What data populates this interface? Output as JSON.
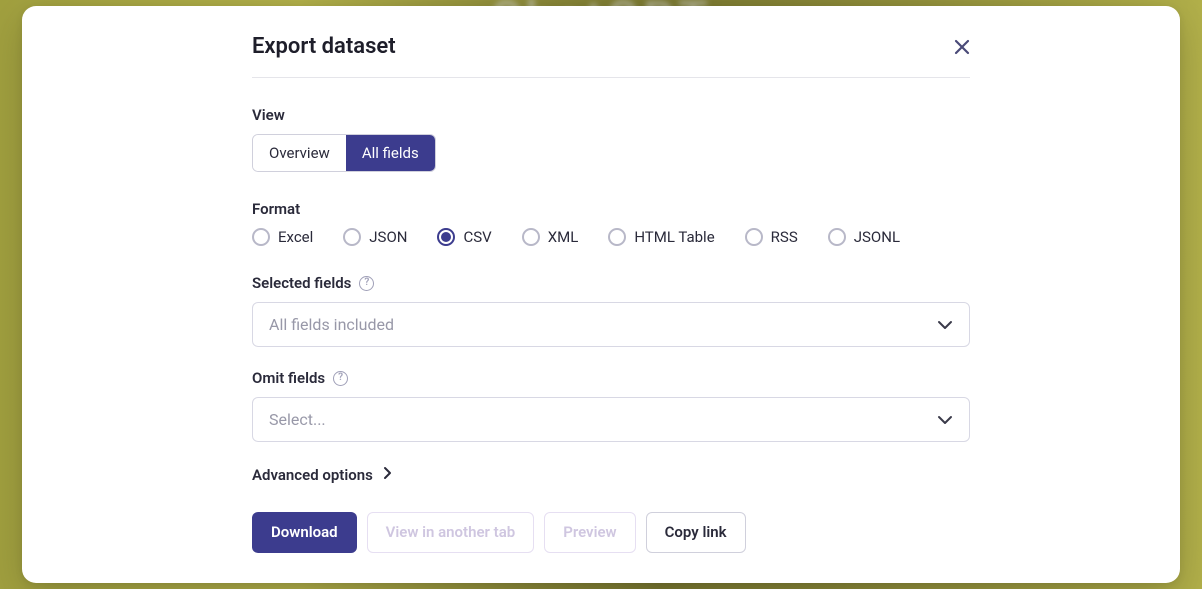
{
  "bg_blur_text": "ChatGPT",
  "modal": {
    "title": "Export dataset",
    "view_label": "View",
    "view_tabs": {
      "overview": "Overview",
      "all_fields": "All fields"
    },
    "format_label": "Format",
    "formats": {
      "excel": "Excel",
      "json": "JSON",
      "csv": "CSV",
      "xml": "XML",
      "html_table": "HTML Table",
      "rss": "RSS",
      "jsonl": "JSONL"
    },
    "selected_fields_label": "Selected fields",
    "selected_fields_placeholder": "All fields included",
    "omit_fields_label": "Omit fields",
    "omit_fields_placeholder": "Select...",
    "advanced_label": "Advanced options",
    "actions": {
      "download": "Download",
      "view_tab": "View in another tab",
      "preview": "Preview",
      "copy_link": "Copy link"
    }
  },
  "state": {
    "active_view": "all_fields",
    "selected_format": "csv"
  }
}
